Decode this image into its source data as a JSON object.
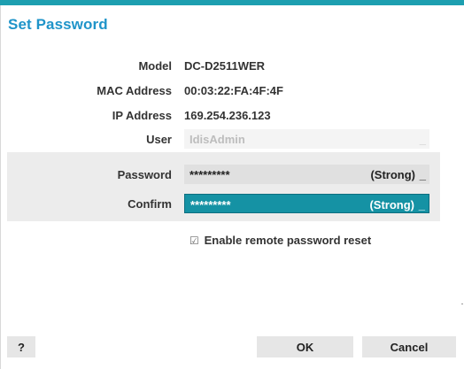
{
  "dialog": {
    "title": "Set Password",
    "accent_color": "#1d9fb0",
    "title_color": "#1f94c9"
  },
  "info": {
    "model_label": "Model",
    "model_value": "DC-D2511WER",
    "mac_label": "MAC Address",
    "mac_value": "00:03:22:FA:4F:4F",
    "ip_label": "IP Address",
    "ip_value": "169.254.236.123",
    "user_label": "User",
    "user_value": "IdisAdmin",
    "user_cursor": "_"
  },
  "password": {
    "label": "Password",
    "value": "*********",
    "strength": "(Strong)",
    "cursor": "_"
  },
  "confirm": {
    "label": "Confirm",
    "value": "*********",
    "strength": "(Strong)",
    "cursor": "_",
    "highlight_color": "#1592a4"
  },
  "options": {
    "enable_remote_reset_checked": true,
    "check_mark": "☑",
    "enable_remote_reset_label": "Enable remote password reset"
  },
  "buttons": {
    "help_label": "?",
    "ok_label": "OK",
    "cancel_label": "Cancel"
  }
}
